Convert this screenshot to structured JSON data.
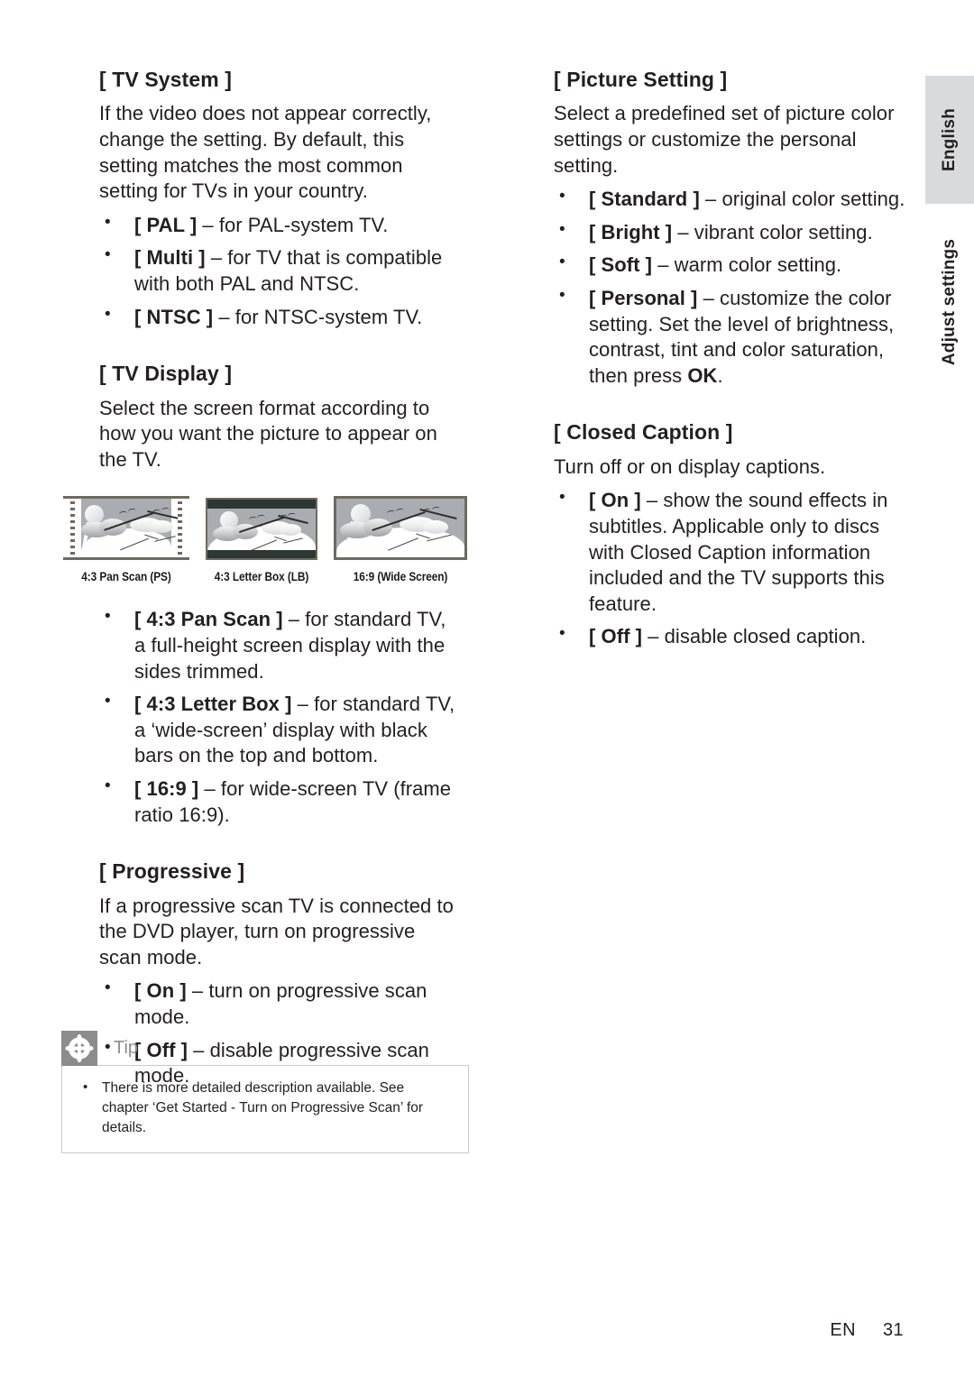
{
  "side": {
    "language_tab": "English",
    "chapter_label": "Adjust settings"
  },
  "footer": {
    "lang_code": "EN",
    "page_number": "31"
  },
  "left_column": {
    "sections": [
      {
        "title": "[ TV System ]",
        "paragraph": "If the video does not appear correctly, change the setting. By default, this setting matches the most common setting for TVs in your country.",
        "bullets": [
          {
            "option": "[ PAL ]",
            "text": " – for PAL-system TV."
          },
          {
            "option": "[ Multi ]",
            "text": " – for TV that is compatible with both PAL and NTSC."
          },
          {
            "option": "[ NTSC ]",
            "text": " – for NTSC-system TV."
          }
        ]
      },
      {
        "title": "[ TV Display ]",
        "paragraph": "Select the screen format according to how you want the picture to appear on the TV.",
        "figure": {
          "panels": [
            {
              "caption": "4:3 Pan Scan (PS)",
              "mode": "pan-scan"
            },
            {
              "caption": "4:3 Letter Box (LB)",
              "mode": "letter-box"
            },
            {
              "caption": "16:9 (Wide Screen)",
              "mode": "wide-screen"
            }
          ]
        },
        "bullets": [
          {
            "option": "[ 4:3 Pan Scan ]",
            "text": " – for standard TV, a full-height screen display with the sides trimmed."
          },
          {
            "option": "[ 4:3 Letter Box ]",
            "text": " – for standard TV,  a ‘wide-screen’ display with black bars on the top and bottom."
          },
          {
            "option": "[ 16:9 ]",
            "text": " – for wide-screen TV (frame ratio 16:9)."
          }
        ]
      },
      {
        "title": "[ Progressive ]",
        "paragraph": "If a progressive scan TV is connected to the DVD player, turn on progressive scan mode.",
        "bullets": [
          {
            "option": "[ On ]",
            "text": " – turn on progressive scan mode."
          },
          {
            "option": "[ Off ]",
            "text": " – disable progressive scan mode."
          }
        ]
      }
    ]
  },
  "right_column": {
    "sections": [
      {
        "title": "[ Picture Setting ]",
        "paragraph": "Select a predefined set of picture color settings or customize the personal setting.",
        "bullets": [
          {
            "option": "[ Standard ]",
            "text": " – original color setting."
          },
          {
            "option": "[ Bright ]",
            "text": " – vibrant color setting."
          },
          {
            "option": "[ Soft ]",
            "text": " – warm color setting."
          },
          {
            "option": "[ Personal ]",
            "text": " – customize the color setting. Set the level of brightness, contrast, tint and color saturation, then press ",
            "suffix_bold": "OK",
            "suffix": "."
          }
        ]
      },
      {
        "title": "[ Closed Caption ]",
        "paragraph": "Turn off or on display captions.",
        "bullets": [
          {
            "option": "[ On ]",
            "text": " – show the sound effects in subtitles. Applicable only to discs with Closed Caption information included and the TV supports this feature."
          },
          {
            "option": "[ Off ]",
            "text": " – disable closed caption."
          }
        ]
      }
    ]
  },
  "tip": {
    "icon": "asterisk-icon",
    "title": "Tip",
    "items": [
      "There is more detailed description available. See chapter ‘Get Started - Turn on Progressive Scan’ for details."
    ]
  },
  "colors": {
    "tab_gray": "#d9dadb",
    "tip_gray": "#8b8c8e",
    "tip_border": "#c9cacb",
    "text": "#231f20",
    "sky": "#a9adb2",
    "letterbox_bar": "#2d3733"
  }
}
